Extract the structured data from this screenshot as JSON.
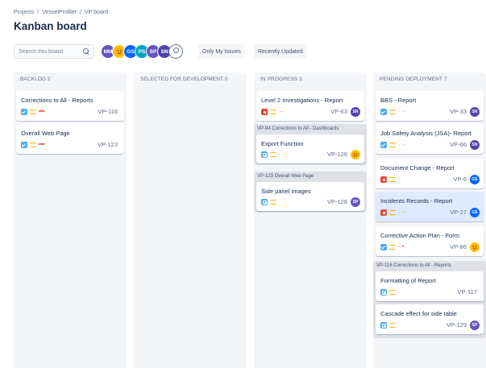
{
  "breadcrumb": {
    "projects": "Projects",
    "project": "VesselProfiler",
    "board": "VP board",
    "sep": "/"
  },
  "page_title": "Kanban board",
  "search": {
    "placeholder": "Search this board"
  },
  "avatars": [
    {
      "initials": "MM",
      "color": "#6554c0"
    },
    {
      "initials": "",
      "color": "#ffc400",
      "icon": "emoji-avatar"
    },
    {
      "initials": "GS",
      "color": "#0065ff"
    },
    {
      "initials": "PS",
      "color": "#00a3bf"
    },
    {
      "initials": "SP",
      "color": "#6554c0"
    },
    {
      "initials": "SN",
      "color": "#5243aa"
    },
    {
      "initials": "",
      "color": "#ffffff",
      "icon": "unassigned-avatar-icon"
    }
  ],
  "filters": {
    "only_my_issues": "Only My Issues",
    "recently_updated": "Recently Updated"
  },
  "columns": [
    {
      "title": "BACKLOG 2",
      "cards": [
        {
          "title": "Corrections to All - Reports",
          "key": "VP-116",
          "type": "task",
          "estimate": "▪▪▪▪",
          "estimate_color": "#de350b"
        },
        {
          "title": "Overall Web Page",
          "key": "VP-123",
          "type": "task",
          "estimate": "▪▪▪▪",
          "estimate_color": "#de350b"
        }
      ]
    },
    {
      "title": "SELECTED FOR DEVELOPMENT 0",
      "cards": []
    },
    {
      "title": "IN PROGRESS 3",
      "cards": [
        {
          "title": "Level 2 Investigations - Report",
          "key": "VP-63",
          "type": "bug",
          "estimate": "→",
          "estimate_color": "#5e6c84",
          "avatar": "SN",
          "avatar_color": "#5243aa"
        }
      ],
      "groups": [
        {
          "title": "VP-94 Corrections to All - Dashboards",
          "cards": [
            {
              "title": "Export Function",
              "key": "VP-126",
              "type": "subtask",
              "estimate": "·",
              "estimate_color": "#5e6c84",
              "avatar": "",
              "avatar_color": "#ffc400"
            }
          ]
        },
        {
          "title": "VP-123 Overall Web Page",
          "cards": [
            {
              "title": "Side panel images",
              "key": "VP-128",
              "type": "subtask",
              "estimate": "",
              "estimate_color": "#5e6c84",
              "avatar": "SP",
              "avatar_color": "#6554c0"
            }
          ]
        }
      ]
    },
    {
      "title": "PENDING DEPLOYMENT 7",
      "cards": [
        {
          "title": "BBS - Report",
          "key": "VP-33",
          "type": "task",
          "estimate": "··→",
          "estimate_color": "#ff991f",
          "avatar": "SN",
          "avatar_color": "#5243aa"
        },
        {
          "title": "Job Safety Analysis (JSA)- Report",
          "key": "VP-66",
          "type": "task",
          "estimate": "··→",
          "estimate_color": "#ff991f",
          "avatar": "SN",
          "avatar_color": "#5243aa"
        },
        {
          "title": "Document Change - Report",
          "key": "VP-6",
          "type": "bug",
          "estimate": "·",
          "estimate_color": "#ff991f",
          "avatar": "GS",
          "avatar_color": "#0065ff"
        },
        {
          "title": "Incidents Records - Report",
          "key": "VP-27",
          "type": "bug",
          "estimate": "··→",
          "estimate_color": "#ff991f",
          "avatar": "GS",
          "avatar_color": "#0065ff",
          "highlighted": true
        },
        {
          "title": "Corrective Action Plan - Form",
          "key": "VP-86",
          "type": "task",
          "estimate": "···•",
          "estimate_color": "#de350b",
          "avatar": "",
          "avatar_color": "#ffc400"
        }
      ],
      "groups": [
        {
          "title": "VP-116 Corrections to All - Reports",
          "cards": [
            {
              "title": "Formatting of Report",
              "key": "VP-117",
              "type": "subtask",
              "estimate": ""
            },
            {
              "title": "Cascade effect for side table",
              "key": "VP-129",
              "type": "subtask",
              "estimate": "",
              "avatar": "SP",
              "avatar_color": "#6554c0"
            }
          ]
        }
      ]
    }
  ]
}
